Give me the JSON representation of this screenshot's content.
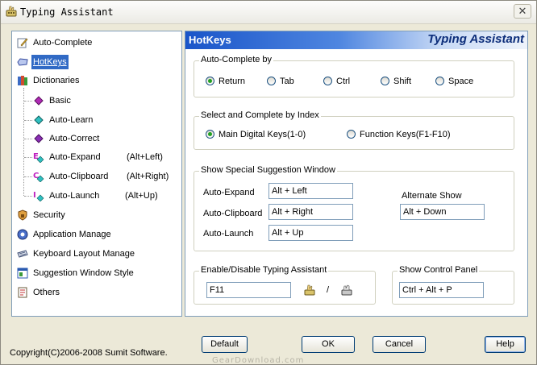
{
  "window": {
    "title": "Typing Assistant"
  },
  "tree": {
    "items": [
      {
        "label": "Auto-Complete"
      },
      {
        "label": "HotKeys"
      },
      {
        "label": "Dictionaries"
      },
      {
        "label": "Basic"
      },
      {
        "label": "Auto-Learn"
      },
      {
        "label": "Auto-Correct"
      },
      {
        "label": "Auto-Expand",
        "hotkey": "(Alt+Left)"
      },
      {
        "label": "Auto-Clipboard",
        "hotkey": "(Alt+Right)"
      },
      {
        "label": "Auto-Launch",
        "hotkey": "(Alt+Up)"
      },
      {
        "label": "Security"
      },
      {
        "label": "Application Manage"
      },
      {
        "label": "Keyboard Layout Manage"
      },
      {
        "label": "Suggestion Window Style"
      },
      {
        "label": "Others"
      }
    ],
    "selected": "HotKeys"
  },
  "panel": {
    "title": "HotKeys",
    "app_name": "Typing Assistant",
    "autocomplete_by": {
      "title": "Auto-Complete by",
      "options": [
        "Return",
        "Tab",
        "Ctrl",
        "Shift",
        "Space"
      ],
      "selected": "Return"
    },
    "select_index": {
      "title": "Select and Complete by Index",
      "options": [
        "Main Digital Keys(1-0)",
        "Function Keys(F1-F10)"
      ],
      "selected": "Main Digital Keys(1-0)"
    },
    "special_window": {
      "title": "Show Special Suggestion Window",
      "rows": [
        {
          "label": "Auto-Expand",
          "value": "Alt + Left"
        },
        {
          "label": "Auto-Clipboard",
          "value": "Alt + Right"
        },
        {
          "label": "Auto-Launch",
          "value": "Alt + Up"
        }
      ],
      "alternate_label": "Alternate Show",
      "alternate_value": "Alt + Down"
    },
    "enable_disable": {
      "title": "Enable/Disable Typing Assistant",
      "value": "F11",
      "separator": "/"
    },
    "control_panel": {
      "title": "Show Control Panel",
      "value": "Ctrl + Alt + P"
    }
  },
  "buttons": {
    "default": "Default",
    "ok": "OK",
    "cancel": "Cancel",
    "help": "Help"
  },
  "footer": {
    "copyright": "Copyright(C)2006-2008 Sumit Software.",
    "watermark": "GearDownload.com"
  },
  "icons": {
    "title": "keyboard-hand-icon",
    "close": "close-icon",
    "enable": "hand-keyboard-icon",
    "disable": "stop-hand-icon"
  },
  "colors": {
    "header_start": "#1a55c9",
    "selection": "#316ac5",
    "radio_on": "#21a121"
  }
}
